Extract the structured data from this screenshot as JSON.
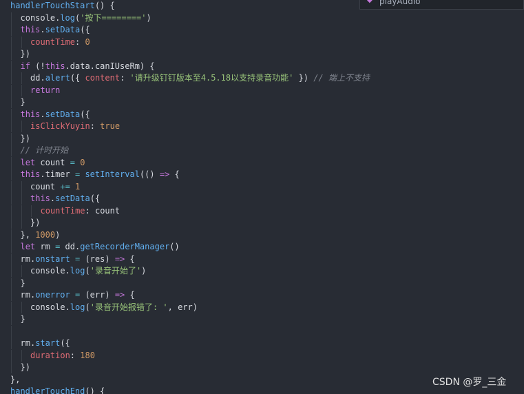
{
  "autocomplete": {
    "suggestion": "playAudio",
    "kind_icon": "method-icon",
    "more_icon": "ellipsis-icon"
  },
  "watermark": "CSDN @罗_三金",
  "colors": {
    "background": "#282c34",
    "plain": "#d7dae0",
    "function": "#61afef",
    "keyword": "#c678dd",
    "property": "#e06c75",
    "number": "#d19a66",
    "string": "#98c379",
    "comment": "#7f848e",
    "operator": "#56b6c2"
  },
  "code": {
    "lines": [
      {
        "indent": 0,
        "tokens": [
          [
            "fn",
            "handlerTouchStart"
          ],
          [
            "pl",
            "() {"
          ]
        ]
      },
      {
        "indent": 1,
        "tokens": [
          [
            "pl",
            "console."
          ],
          [
            "fn",
            "log"
          ],
          [
            "pl",
            "("
          ],
          [
            "st",
            "'按下========'"
          ],
          [
            "pl",
            ")"
          ]
        ]
      },
      {
        "indent": 1,
        "tokens": [
          [
            "kw",
            "this"
          ],
          [
            "pl",
            "."
          ],
          [
            "fn",
            "setData"
          ],
          [
            "pl",
            "({"
          ]
        ]
      },
      {
        "indent": 2,
        "tokens": [
          [
            "pr",
            "countTime"
          ],
          [
            "pl",
            ": "
          ],
          [
            "nu",
            "0"
          ]
        ]
      },
      {
        "indent": 1,
        "tokens": [
          [
            "pl",
            "})"
          ]
        ]
      },
      {
        "indent": 1,
        "tokens": [
          [
            "kw",
            "if"
          ],
          [
            "pl",
            " (!"
          ],
          [
            "kw",
            "this"
          ],
          [
            "pl",
            ".data.canIUseRm) {"
          ]
        ]
      },
      {
        "indent": 2,
        "tokens": [
          [
            "pl",
            "dd."
          ],
          [
            "fn",
            "alert"
          ],
          [
            "pl",
            "({ "
          ],
          [
            "pr",
            "content"
          ],
          [
            "pl",
            ": "
          ],
          [
            "st",
            "'请升级钉钉版本至4.5.18以支持录音功能'"
          ],
          [
            "pl",
            " }) "
          ],
          [
            "cm",
            "// 端上不支持"
          ]
        ]
      },
      {
        "indent": 2,
        "tokens": [
          [
            "kw",
            "return"
          ]
        ]
      },
      {
        "indent": 1,
        "tokens": [
          [
            "pl",
            "}"
          ]
        ]
      },
      {
        "indent": 1,
        "tokens": [
          [
            "kw",
            "this"
          ],
          [
            "pl",
            "."
          ],
          [
            "fn",
            "setData"
          ],
          [
            "pl",
            "({"
          ]
        ]
      },
      {
        "indent": 2,
        "tokens": [
          [
            "pr",
            "isClickYuyin"
          ],
          [
            "pl",
            ": "
          ],
          [
            "nu",
            "true"
          ]
        ]
      },
      {
        "indent": 1,
        "tokens": [
          [
            "pl",
            "})"
          ]
        ]
      },
      {
        "indent": 1,
        "tokens": [
          [
            "cm",
            "// 计时开始"
          ]
        ]
      },
      {
        "indent": 1,
        "tokens": [
          [
            "kw",
            "let"
          ],
          [
            "pl",
            " count "
          ],
          [
            "op",
            "="
          ],
          [
            "pl",
            " "
          ],
          [
            "nu",
            "0"
          ]
        ]
      },
      {
        "indent": 1,
        "tokens": [
          [
            "kw",
            "this"
          ],
          [
            "pl",
            ".timer "
          ],
          [
            "op",
            "="
          ],
          [
            "pl",
            " "
          ],
          [
            "fn",
            "setInterval"
          ],
          [
            "pl",
            "(() "
          ],
          [
            "kw",
            "=>"
          ],
          [
            "pl",
            " {"
          ]
        ]
      },
      {
        "indent": 2,
        "tokens": [
          [
            "pl",
            "count "
          ],
          [
            "op",
            "+="
          ],
          [
            "pl",
            " "
          ],
          [
            "nu",
            "1"
          ]
        ]
      },
      {
        "indent": 2,
        "tokens": [
          [
            "kw",
            "this"
          ],
          [
            "pl",
            "."
          ],
          [
            "fn",
            "setData"
          ],
          [
            "pl",
            "({"
          ]
        ]
      },
      {
        "indent": 3,
        "tokens": [
          [
            "pr",
            "countTime"
          ],
          [
            "pl",
            ": count"
          ]
        ]
      },
      {
        "indent": 2,
        "tokens": [
          [
            "pl",
            "})"
          ]
        ]
      },
      {
        "indent": 1,
        "tokens": [
          [
            "pl",
            "}, "
          ],
          [
            "nu",
            "1000"
          ],
          [
            "pl",
            ")"
          ]
        ]
      },
      {
        "indent": 1,
        "tokens": [
          [
            "kw",
            "let"
          ],
          [
            "pl",
            " rm "
          ],
          [
            "op",
            "="
          ],
          [
            "pl",
            " dd."
          ],
          [
            "fn",
            "getRecorderManager"
          ],
          [
            "pl",
            "()"
          ]
        ]
      },
      {
        "indent": 1,
        "tokens": [
          [
            "pl",
            "rm."
          ],
          [
            "fn",
            "onstart"
          ],
          [
            "pl",
            " "
          ],
          [
            "op",
            "="
          ],
          [
            "pl",
            " (res) "
          ],
          [
            "kw",
            "=>"
          ],
          [
            "pl",
            " {"
          ]
        ]
      },
      {
        "indent": 2,
        "tokens": [
          [
            "pl",
            "console."
          ],
          [
            "fn",
            "log"
          ],
          [
            "pl",
            "("
          ],
          [
            "st",
            "'录音开始了'"
          ],
          [
            "pl",
            ")"
          ]
        ]
      },
      {
        "indent": 1,
        "tokens": [
          [
            "pl",
            "}"
          ]
        ]
      },
      {
        "indent": 1,
        "tokens": [
          [
            "pl",
            "rm."
          ],
          [
            "fn",
            "onerror"
          ],
          [
            "pl",
            " "
          ],
          [
            "op",
            "="
          ],
          [
            "pl",
            " (err) "
          ],
          [
            "kw",
            "=>"
          ],
          [
            "pl",
            " {"
          ]
        ]
      },
      {
        "indent": 2,
        "tokens": [
          [
            "pl",
            "console."
          ],
          [
            "fn",
            "log"
          ],
          [
            "pl",
            "("
          ],
          [
            "st",
            "'录音开始报错了: '"
          ],
          [
            "pl",
            ", err)"
          ]
        ]
      },
      {
        "indent": 1,
        "tokens": [
          [
            "pl",
            "}"
          ]
        ]
      },
      {
        "indent": 1,
        "tokens": []
      },
      {
        "indent": 1,
        "tokens": [
          [
            "pl",
            "rm."
          ],
          [
            "fn",
            "start"
          ],
          [
            "pl",
            "({"
          ]
        ]
      },
      {
        "indent": 2,
        "tokens": [
          [
            "pr",
            "duration"
          ],
          [
            "pl",
            ": "
          ],
          [
            "nu",
            "180"
          ]
        ]
      },
      {
        "indent": 1,
        "tokens": [
          [
            "pl",
            "})"
          ]
        ]
      },
      {
        "indent": 0,
        "tokens": [
          [
            "pl",
            "},"
          ]
        ]
      },
      {
        "indent": 0,
        "tokens": [
          [
            "fn",
            "handlerTouchEnd"
          ],
          [
            "pl",
            "() {"
          ]
        ]
      }
    ]
  }
}
